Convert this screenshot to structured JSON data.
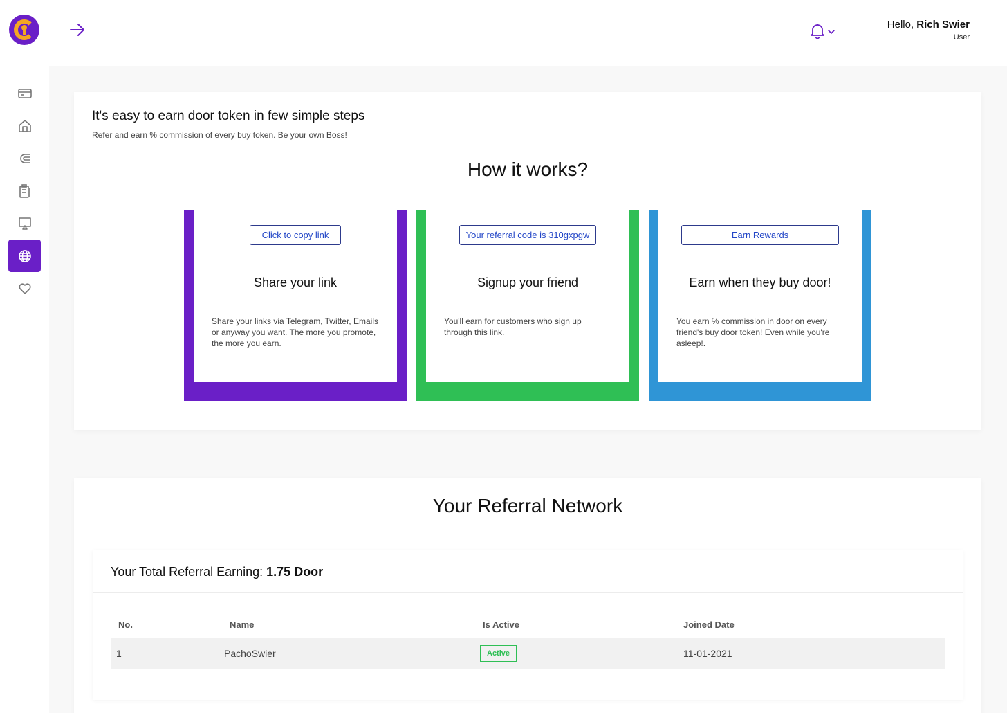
{
  "header": {
    "greeting_prefix": "Hello,",
    "user_name": "Rich Swier",
    "role": "User"
  },
  "sidebar": {
    "items": [
      {
        "icon": "card-icon"
      },
      {
        "icon": "home-icon"
      },
      {
        "icon": "magnet-icon"
      },
      {
        "icon": "clipboard-icon"
      },
      {
        "icon": "monitor-icon"
      },
      {
        "icon": "globe-icon",
        "active": true
      },
      {
        "icon": "heart-icon"
      }
    ]
  },
  "intro": {
    "title": "It's easy to earn door token in few simple steps",
    "subtitle": "Refer and earn % commission of every buy token. Be your own Boss!",
    "how_title": "How it works?"
  },
  "steps": [
    {
      "button": "Click to copy link",
      "title": "Share your link",
      "text": "Share your links via Telegram, Twitter, Emails or anyway you want. The more you promote, the more you earn.",
      "color": "#6a1fc7"
    },
    {
      "button": "Your referral code is 310gxpgw",
      "title": "Signup your friend",
      "text": "You'll earn for customers who sign up through this link.",
      "color": "#2fbf55"
    },
    {
      "button": "Earn Rewards",
      "title": "Earn when they buy door!",
      "text": "You earn % commission in door on every friend's buy door token! Even while you're asleep!.",
      "color": "#2f95d6"
    }
  ],
  "network": {
    "title": "Your Referral Network",
    "earning_label": "Your Total Referral Earning:",
    "earning_value": "1.75 Door",
    "columns": [
      "No.",
      "Name",
      "Is Active",
      "Joined Date"
    ],
    "rows": [
      {
        "no": "1",
        "name": "PachoSwier",
        "status": "Active",
        "joined": "11-01-2021"
      }
    ]
  },
  "colors": {
    "accent": "#6a1fc7",
    "logo_ring": "#f5a623",
    "active_badge": "#2fbf55"
  }
}
